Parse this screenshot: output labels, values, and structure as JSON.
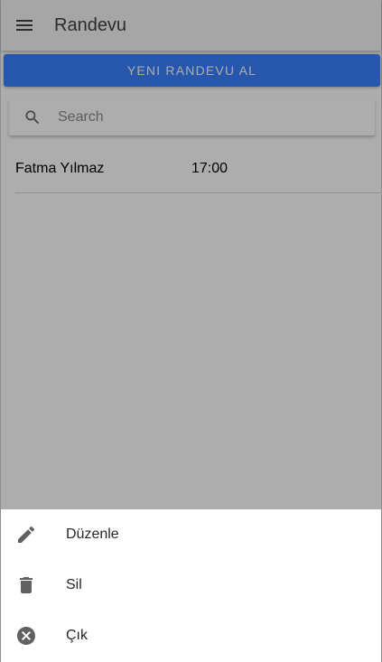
{
  "toolbar": {
    "menu_icon": "menu-icon",
    "title": "Randevu"
  },
  "main": {
    "new_appointment_label": "YENI RANDEVU AL",
    "search": {
      "icon": "search-icon",
      "placeholder": "Search",
      "value": ""
    },
    "appointments": [
      {
        "name": "Fatma Yılmaz",
        "time": "17:00"
      }
    ]
  },
  "action_sheet": {
    "items": [
      {
        "icon": "pencil-icon",
        "label": "Düzenle"
      },
      {
        "icon": "trash-icon",
        "label": "Sil"
      },
      {
        "icon": "close-circle-icon",
        "label": "Çık"
      }
    ]
  },
  "colors": {
    "primary": "#3880ff",
    "toolbar_bg": "#f5f5f5",
    "backdrop": "rgba(0,0,0,0.32)"
  }
}
